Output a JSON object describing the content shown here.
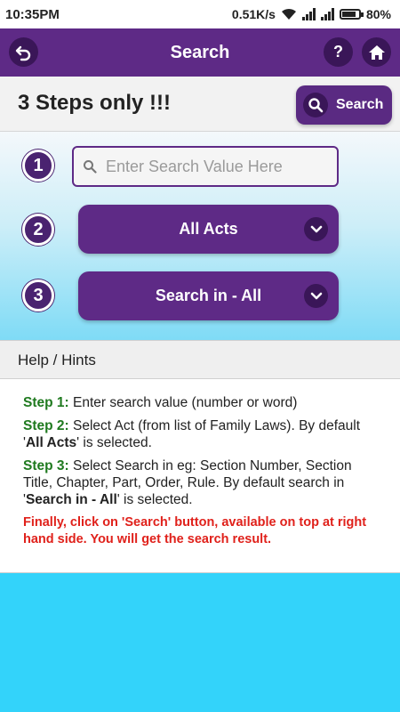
{
  "status_bar": {
    "time": "10:35PM",
    "network_speed": "0.51K/s",
    "battery": "80%"
  },
  "header": {
    "title": "Search",
    "help_label": "?"
  },
  "steps_row": {
    "title": "3 Steps only !!!",
    "search_button_label": "Search"
  },
  "steps": {
    "step1_number": "1",
    "step2_number": "2",
    "step3_number": "3",
    "search_placeholder": "Enter Search Value Here",
    "search_value": "",
    "act_select_value": "All Acts",
    "search_in_value": "Search in - All"
  },
  "help": {
    "heading": "Help / Hints",
    "step1_label": "Step 1:",
    "step1_text": "Enter search value (number or word)",
    "step2_label": "Step 2:",
    "step2_text_a": "Select Act (from list of Family Laws). By default '",
    "step2_bold": "All Acts",
    "step2_text_b": "' is selected.",
    "step3_label": "Step 3:",
    "step3_text_a": "Select Search in eg: Section Number, Section Title, Chapter, Part, Order, Rule. By default search in '",
    "step3_bold": "Search in - All",
    "step3_text_b": "' is selected.",
    "final": "Finally, click on 'Search' button, available on top at right hand side. You will get the search result."
  },
  "colors": {
    "primary": "#5e2a86",
    "primary_dark": "#3a1658",
    "background": "#33d3fa",
    "step_label": "#1f7a1f",
    "warning": "#e0211b"
  },
  "icons": [
    "back-icon",
    "help-icon",
    "home-icon",
    "search-icon",
    "chevron-down-icon",
    "wifi-icon",
    "signal-icon",
    "battery-icon"
  ]
}
